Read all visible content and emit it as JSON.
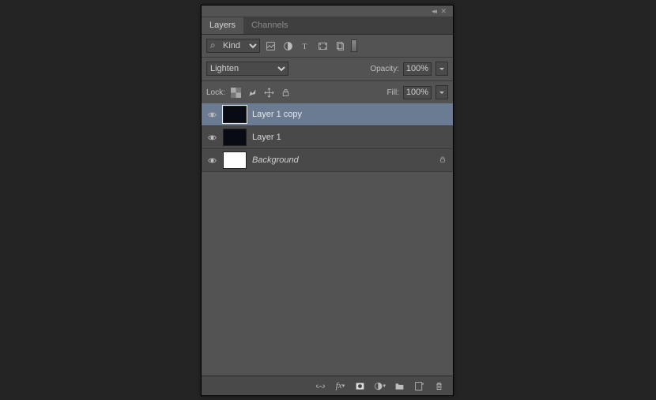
{
  "tabs": {
    "layers": "Layers",
    "channels": "Channels"
  },
  "filter": {
    "kind": "Kind"
  },
  "blend": {
    "mode": "Lighten",
    "opacity_label": "Opacity:",
    "opacity_value": "100%"
  },
  "lock": {
    "label": "Lock:",
    "fill_label": "Fill:",
    "fill_value": "100%"
  },
  "layers": [
    {
      "name": "Layer 1 copy",
      "thumb": "black",
      "selected": true,
      "italic": false,
      "locked": false
    },
    {
      "name": "Layer 1",
      "thumb": "black",
      "selected": false,
      "italic": false,
      "locked": false
    },
    {
      "name": "Background",
      "thumb": "white",
      "selected": false,
      "italic": true,
      "locked": true
    }
  ]
}
